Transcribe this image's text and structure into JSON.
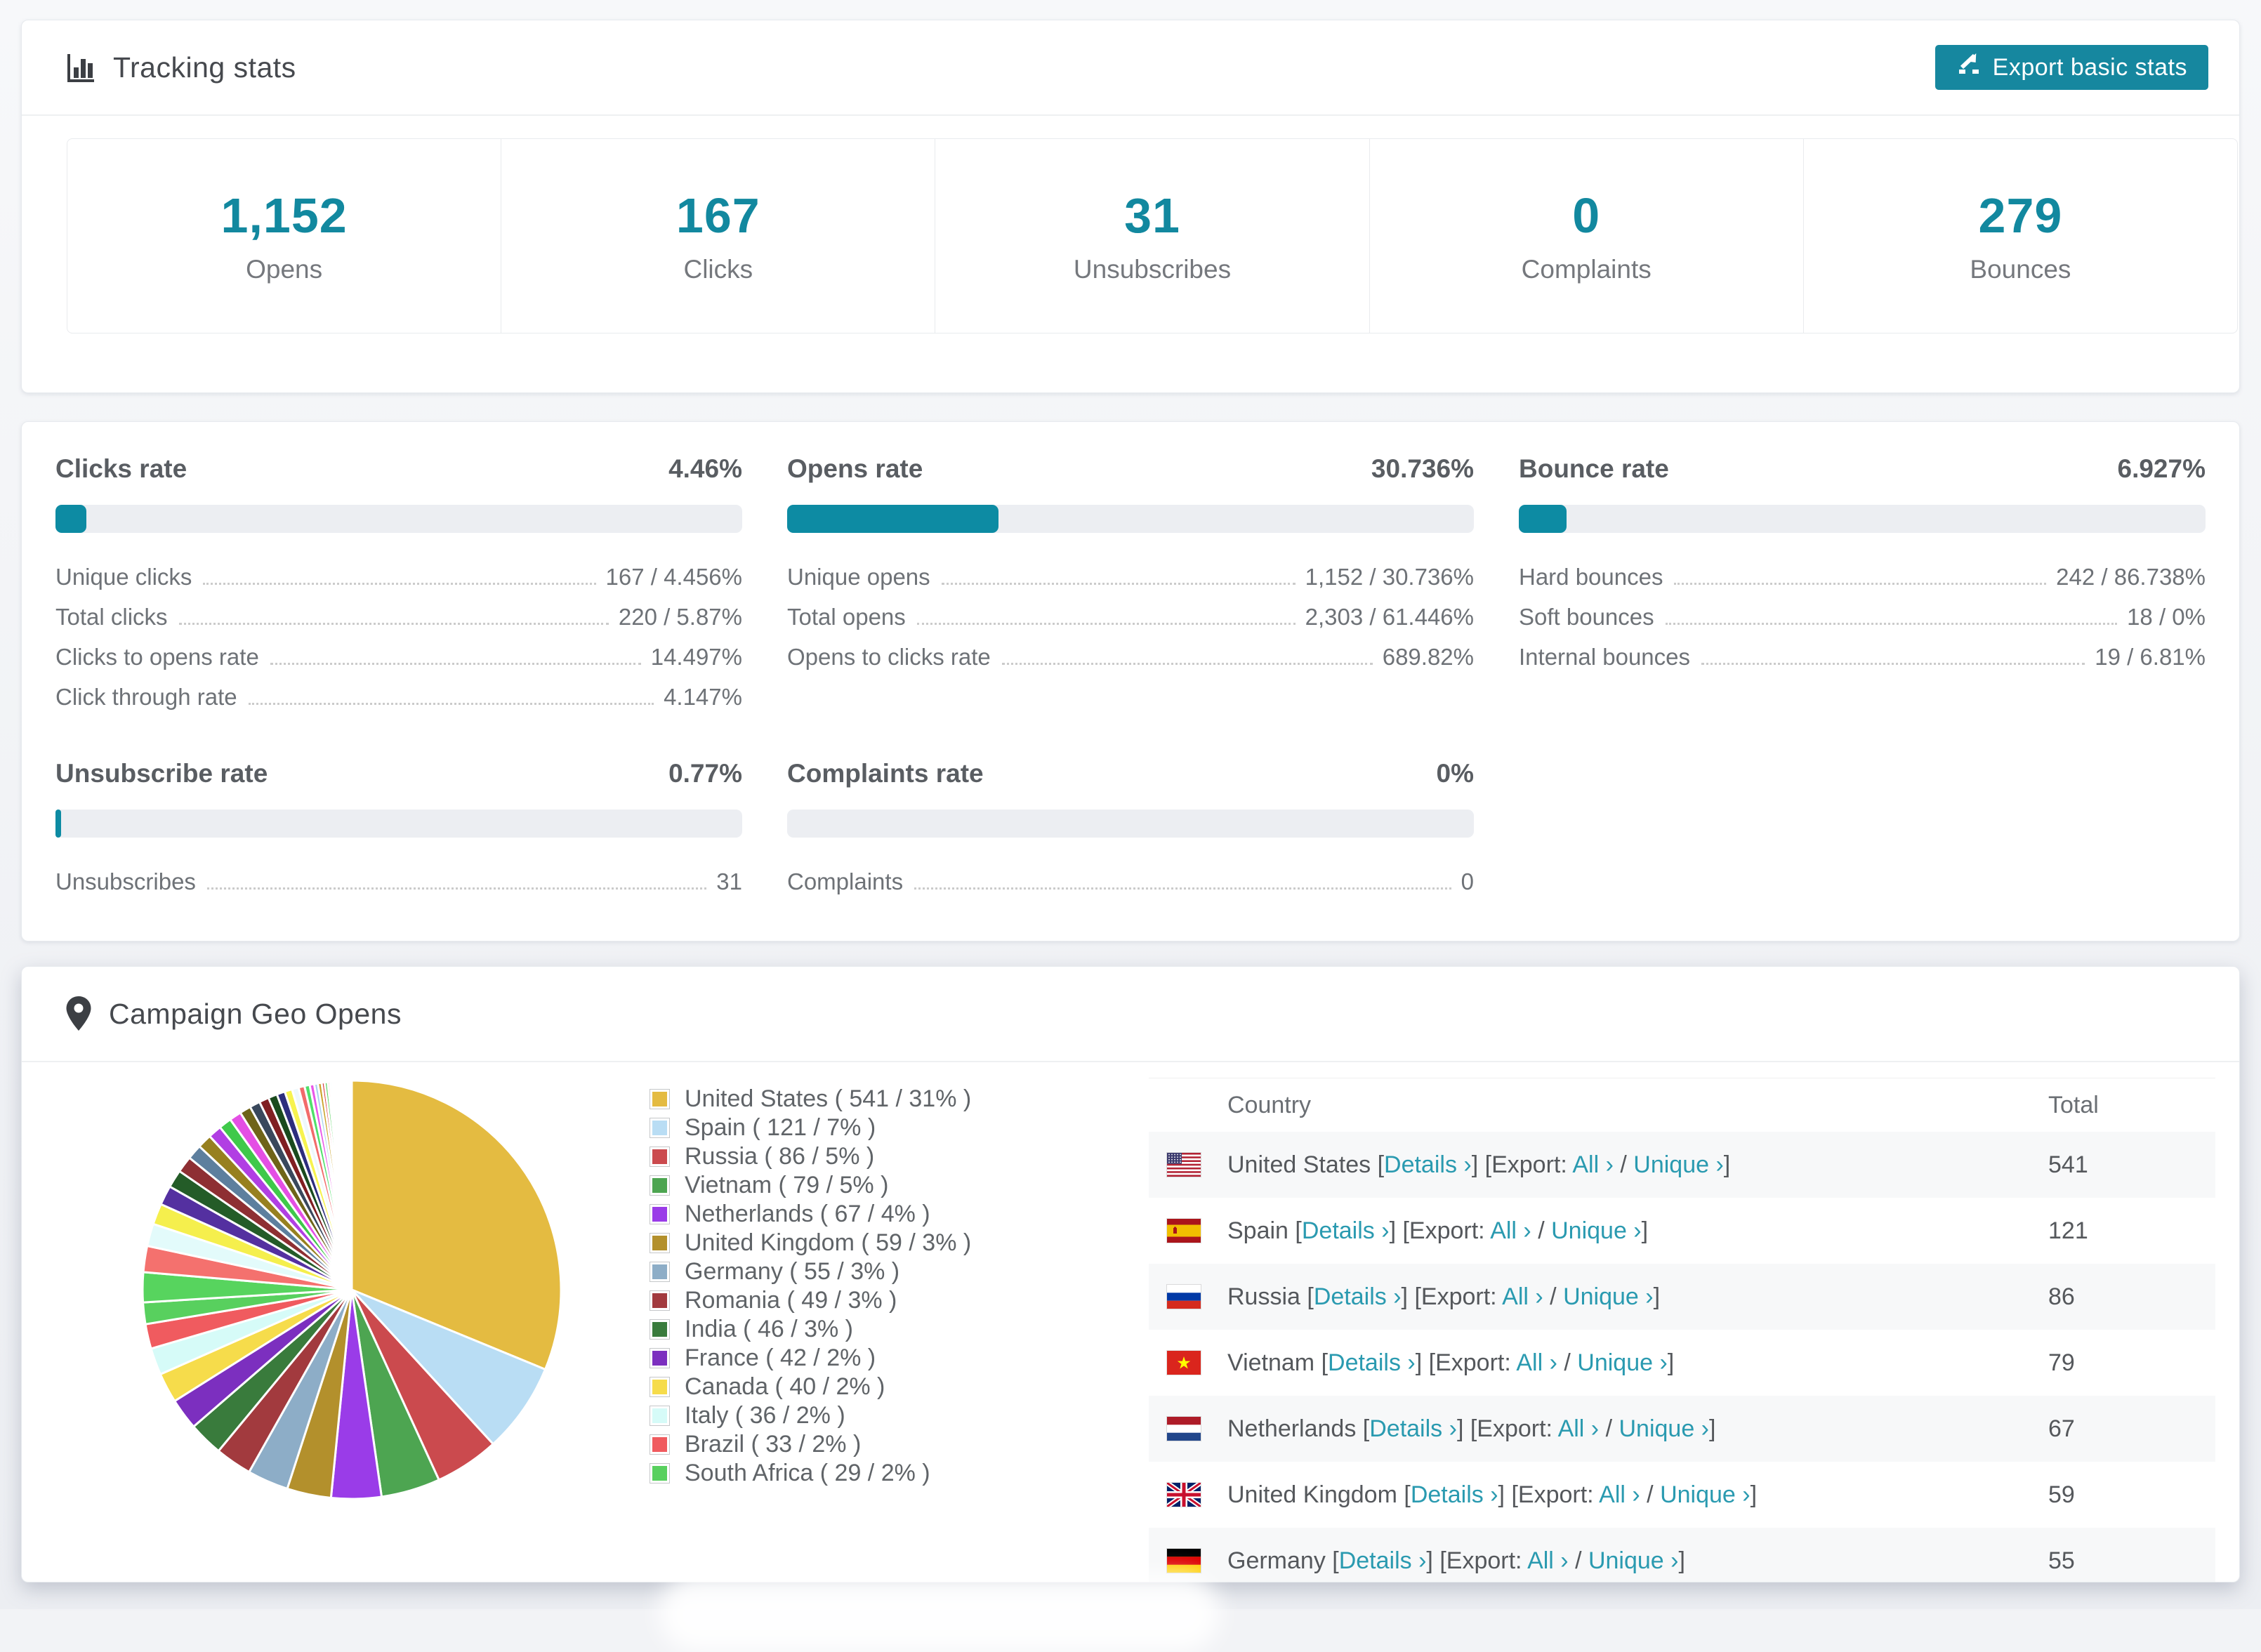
{
  "colors": {
    "accent": "#0d8ba3",
    "link": "#2a9ab0",
    "bar_track": "#eceef2",
    "zebra_row": "#f7f8f9",
    "button_bg": "#16879f"
  },
  "tracking": {
    "title": "Tracking stats",
    "export_button": "Export basic stats",
    "stats": [
      {
        "value": "1,152",
        "label": "Opens"
      },
      {
        "value": "167",
        "label": "Clicks"
      },
      {
        "value": "31",
        "label": "Unsubscribes"
      },
      {
        "value": "0",
        "label": "Complaints"
      },
      {
        "value": "279",
        "label": "Bounces"
      }
    ]
  },
  "rates": {
    "panels": [
      {
        "title": "Clicks rate",
        "value": "4.46%",
        "percent": 4.46,
        "rows": [
          {
            "label": "Unique clicks",
            "value": "167 / 4.456%"
          },
          {
            "label": "Total clicks",
            "value": "220 / 5.87%"
          },
          {
            "label": "Clicks to opens rate",
            "value": "14.497%"
          },
          {
            "label": "Click through rate",
            "value": "4.147%"
          }
        ]
      },
      {
        "title": "Opens rate",
        "value": "30.736%",
        "percent": 30.736,
        "rows": [
          {
            "label": "Unique opens",
            "value": "1,152 / 30.736%"
          },
          {
            "label": "Total opens",
            "value": "2,303 / 61.446%"
          },
          {
            "label": "Opens to clicks rate",
            "value": "689.82%"
          }
        ]
      },
      {
        "title": "Bounce rate",
        "value": "6.927%",
        "percent": 6.927,
        "rows": [
          {
            "label": "Hard bounces",
            "value": "242 / 86.738%"
          },
          {
            "label": "Soft bounces",
            "value": "18 / 0%"
          },
          {
            "label": "Internal bounces",
            "value": "19 / 6.81%"
          }
        ]
      },
      {
        "title": "Unsubscribe rate",
        "value": "0.77%",
        "percent": 0.77,
        "rows": [
          {
            "label": "Unsubscribes",
            "value": "31"
          }
        ]
      },
      {
        "title": "Complaints rate",
        "value": "0%",
        "percent": 0,
        "rows": [
          {
            "label": "Complaints",
            "value": "0"
          }
        ]
      }
    ]
  },
  "geo": {
    "title": "Campaign Geo Opens",
    "table": {
      "headers": {
        "country": "Country",
        "total": "Total"
      },
      "link_parts": {
        "open": "[",
        "close": "]",
        "details": "Details ›",
        "export": "Export:",
        "all": "All ›",
        "sep": " / ",
        "unique": "Unique ›"
      },
      "rows": [
        {
          "country": "United States",
          "flag": "us",
          "total": "541"
        },
        {
          "country": "Spain",
          "flag": "es",
          "total": "121"
        },
        {
          "country": "Russia",
          "flag": "ru",
          "total": "86"
        },
        {
          "country": "Vietnam",
          "flag": "vn",
          "total": "79"
        },
        {
          "country": "Netherlands",
          "flag": "nl",
          "total": "67"
        },
        {
          "country": "United Kingdom",
          "flag": "gb",
          "total": "59"
        },
        {
          "country": "Germany",
          "flag": "de",
          "total": "55"
        }
      ]
    }
  },
  "chart_data": {
    "type": "pie",
    "title": "Campaign Geo Opens",
    "legend_position": "right",
    "start_angle_deg": -90,
    "direction": "clockwise",
    "legend_format": "{name} ( {value} / {pct}% )",
    "series": [
      {
        "name": "United States",
        "value": 541,
        "pct": 31,
        "color": "#e4bb41"
      },
      {
        "name": "Spain",
        "value": 121,
        "pct": 7,
        "color": "#b9ddf4"
      },
      {
        "name": "Russia",
        "value": 86,
        "pct": 5,
        "color": "#cb4a4e"
      },
      {
        "name": "Vietnam",
        "value": 79,
        "pct": 5,
        "color": "#4da551"
      },
      {
        "name": "Netherlands",
        "value": 67,
        "pct": 4,
        "color": "#9a3ce8"
      },
      {
        "name": "United Kingdom",
        "value": 59,
        "pct": 3,
        "color": "#b3902c"
      },
      {
        "name": "Germany",
        "value": 55,
        "pct": 3,
        "color": "#8dadc7"
      },
      {
        "name": "Romania",
        "value": 49,
        "pct": 3,
        "color": "#a23a3e"
      },
      {
        "name": "India",
        "value": 46,
        "pct": 3,
        "color": "#397b3c"
      },
      {
        "name": "France",
        "value": 42,
        "pct": 2,
        "color": "#7c2fbf"
      },
      {
        "name": "Canada",
        "value": 40,
        "pct": 2,
        "color": "#f6dc4b"
      },
      {
        "name": "Italy",
        "value": 36,
        "pct": 2,
        "color": "#d6fbf8"
      },
      {
        "name": "Brazil",
        "value": 33,
        "pct": 2,
        "color": "#f05b5f"
      },
      {
        "name": "South Africa",
        "value": 29,
        "pct": 2,
        "color": "#58d05e"
      }
    ],
    "others": {
      "note": "many small unlabeled country slices fanning to 12 o'clock",
      "values": [
        40,
        35,
        30,
        28,
        26,
        24,
        22,
        20,
        19,
        18,
        17,
        16,
        15,
        14,
        13,
        12,
        11,
        10,
        9,
        8,
        7,
        6,
        5,
        5,
        4,
        4,
        3,
        3,
        2,
        2,
        2,
        2,
        1,
        1,
        1,
        1,
        1,
        1,
        1,
        1,
        1,
        1,
        1,
        1,
        1,
        1,
        1,
        1,
        1,
        1
      ],
      "palette": [
        "#57d45e",
        "#f4716e",
        "#e3fbfb",
        "#f5ef4d",
        "#5430a0",
        "#245c28",
        "#8e2f33",
        "#5d7f9e",
        "#97801f",
        "#b13fe3",
        "#3fc94a",
        "#e44fe4",
        "#6f6418",
        "#39485c",
        "#801f22",
        "#1a4a1e",
        "#2d2d7d",
        "#f7f34f",
        "#eef8fb",
        "#f26b6b",
        "#4fe06a",
        "#e957e9",
        "#a9d2ef",
        "#c9a227",
        "#d93b3f"
      ]
    }
  }
}
